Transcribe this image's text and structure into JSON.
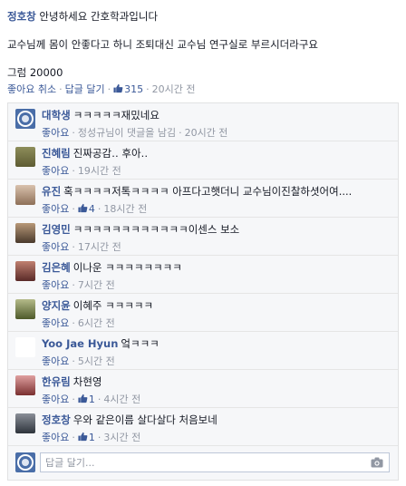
{
  "post": {
    "author": "정호창",
    "line1": "안녕하세요 간호학과입니다",
    "line2": "교수님께 몸이 안좋다고 하니 조퇴대신 교수님 연구실로 부르시더라구요",
    "line3": "그럼 20000"
  },
  "actions": {
    "unlike": "좋아요 취소",
    "reply": "답글 달기",
    "like_count": "315",
    "time": "20시간 전"
  },
  "comments": [
    {
      "name": "대학생",
      "text": "ㅋㅋㅋㅋㅋ재밌네요",
      "like": "좋아요",
      "extra": "정성규님이 댓글을 남김",
      "time": "20시간 전",
      "avatar_color": "#4a6ea8"
    },
    {
      "name": "진혜림",
      "text": "진짜공감‥ 후아‥",
      "like": "좋아요",
      "time": "19시간 전",
      "avatar_color": "#7a6a3a"
    },
    {
      "name": "유진",
      "text": "혹ㅋㅋㅋㅋ저톡ㅋㅋㅋㅋ 아프다고햇더니 교수님이진찰하셧어여....",
      "like": "좋아요",
      "likes": "4",
      "time": "18시간 전",
      "avatar_color": "#a88a70"
    },
    {
      "name": "김영민",
      "text": "ㅋㅋㅋㅋㅋㅋㅋㅋㅋㅋㅋㅋ이센스 보소",
      "like": "좋아요",
      "time": "17시간 전",
      "avatar_color": "#6b5a48"
    },
    {
      "name": "김은혜",
      "text": "이나운 ㅋㅋㅋㅋㅋㅋㅋㅋ",
      "like": "좋아요",
      "time": "7시간 전",
      "avatar_color": "#8a4a44"
    },
    {
      "name": "양지윤",
      "text": "이혜주 ㅋㅋㅋㅋㅋ",
      "like": "좋아요",
      "time": "6시간 전",
      "avatar_color": "#6f7a3e"
    },
    {
      "name": "Yoo Jae Hyun",
      "text": "엌ㅋㅋㅋ",
      "like": "좋아요",
      "time": "5시간 전",
      "avatar_color": "#ffffff"
    },
    {
      "name": "한유림",
      "text": "차현영",
      "like": "좋아요",
      "likes": "1",
      "time": "4시간 전",
      "avatar_color": "#9a5050"
    },
    {
      "name": "정호창",
      "text": "우와 같은이름 살다살다 처음보네",
      "like": "좋아요",
      "likes": "1",
      "time": "3시간 전",
      "avatar_color": "#3e4650"
    }
  ],
  "reply_box": {
    "placeholder": "답글 달기...",
    "avatar_color": "#4a6ea8"
  },
  "colors": {
    "link": "#3b5998",
    "meta": "#9197a3",
    "panel": "#f6f7f9"
  }
}
